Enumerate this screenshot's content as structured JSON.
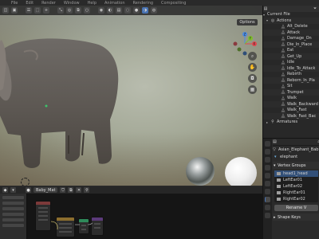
{
  "menu": {
    "items": [
      "File",
      "Edit",
      "Render",
      "Window",
      "Help",
      "Animation",
      "Rendering",
      "Compositing"
    ]
  },
  "viewport": {
    "options_label": "Options",
    "gizmo": {
      "x_label": "X",
      "y_label": "Y",
      "z_label": "Z"
    },
    "nav_icons": [
      "zoom-icon",
      "pan-icon",
      "camera-icon",
      "grid-icon"
    ]
  },
  "node_editor": {
    "material_name": "Baby_Mat"
  },
  "outliner": {
    "current_file": "Current File",
    "actions_label": "Actions",
    "actions": [
      "Alt_Delete",
      "Attack",
      "Damage_On",
      "Die_In_Place",
      "Eat",
      "Get_Up",
      "Idle",
      "Idle_To_Attack",
      "Rebirth",
      "Reborn_In_Pla",
      "Sit",
      "Trumpet",
      "Walk",
      "Walk_Backward",
      "Walk_Fast",
      "Walk_Fast_Bac"
    ],
    "armatures_label": "Armatures"
  },
  "properties": {
    "object_name": "Asian_Elephant_Bab",
    "mesh_name": "elephant",
    "vertex_groups_label": "Vertex Groups",
    "vertex_groups": [
      "head1_head",
      "LeftEar01",
      "LeftEar02",
      "RightEar01",
      "RightEar02"
    ],
    "rename_button": "Rename V",
    "shape_keys_label": "Shape Keys"
  },
  "colors": {
    "accent": "#4772b3",
    "selection": "#335078",
    "x_axis": "#e0474f",
    "y_axis": "#7fbd2b",
    "z_axis": "#4a8be3"
  }
}
